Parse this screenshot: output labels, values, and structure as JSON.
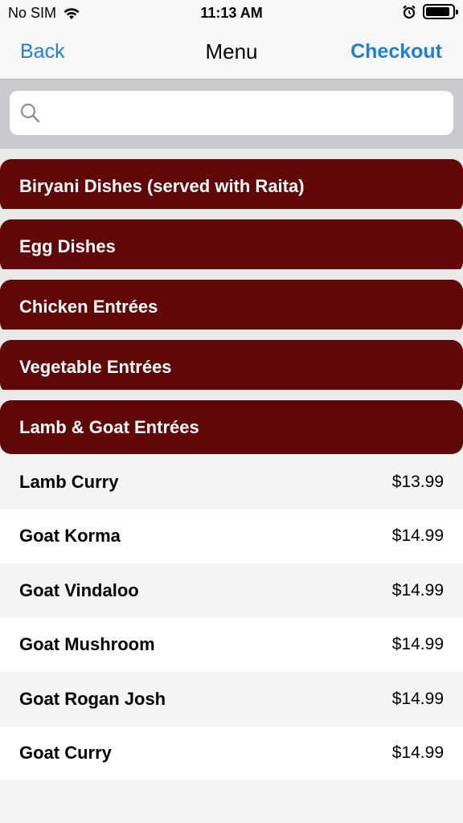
{
  "status": {
    "carrier": "No SIM",
    "time": "11:13 AM",
    "battery_level": 0.9
  },
  "nav": {
    "back_label": "Back",
    "title": "Menu",
    "checkout_label": "Checkout"
  },
  "search": {
    "placeholder": "",
    "value": ""
  },
  "categories": [
    {
      "label": "Biryani Dishes (served with Raita)"
    },
    {
      "label": "Egg Dishes"
    },
    {
      "label": "Chicken Entrées"
    },
    {
      "label": "Vegetable Entrées"
    },
    {
      "label": "Lamb & Goat Entrées"
    }
  ],
  "items": [
    {
      "name": "Lamb Curry",
      "price": "$13.99"
    },
    {
      "name": "Goat Korma",
      "price": "$14.99"
    },
    {
      "name": "Goat Vindaloo",
      "price": "$14.99"
    },
    {
      "name": "Goat Mushroom",
      "price": "$14.99"
    },
    {
      "name": "Goat Rogan Josh",
      "price": "$14.99"
    },
    {
      "name": "Goat Curry",
      "price": "$14.99"
    }
  ],
  "colors": {
    "accent": "#1f7fd4",
    "category_bg": "#600808"
  }
}
